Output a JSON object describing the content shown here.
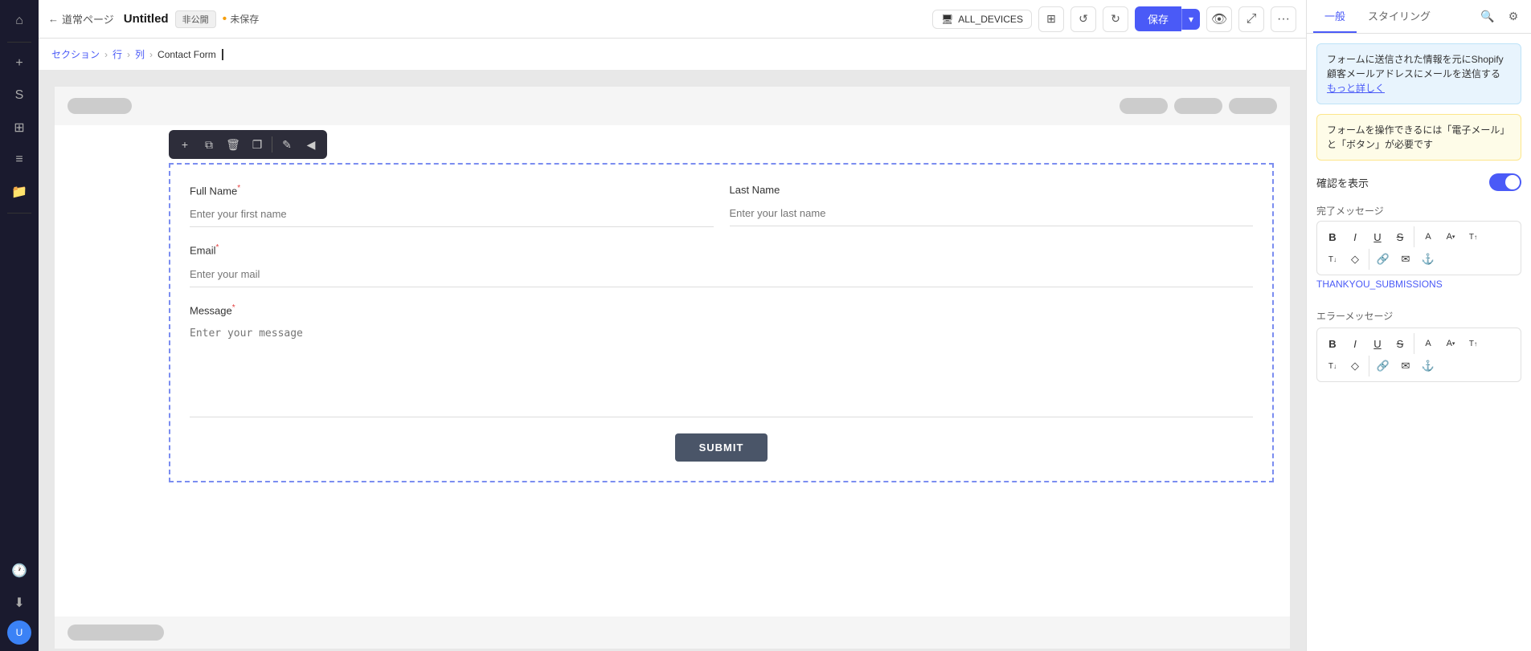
{
  "topbar": {
    "back_label": "道常ページ",
    "title": "Untitled",
    "visibility_badge": "非公開",
    "unsaved_label": "未保存",
    "device_label": "ALL_DEVICES",
    "save_label": "保存",
    "dropdown_icon": "▾",
    "more_icon": "···"
  },
  "breadcrumb": {
    "items": [
      "セクション",
      "行",
      "列",
      "Contact Form"
    ],
    "separators": [
      "›",
      "›",
      "›"
    ]
  },
  "floating_toolbar": {
    "buttons": [
      {
        "icon": "+",
        "name": "add"
      },
      {
        "icon": "⧉",
        "name": "duplicate"
      },
      {
        "icon": "🗑",
        "name": "delete"
      },
      {
        "icon": "❐",
        "name": "copy"
      },
      {
        "icon": "✏",
        "name": "edit"
      },
      {
        "icon": "◀",
        "name": "collapse"
      }
    ]
  },
  "form": {
    "full_name_label": "Full Name",
    "full_name_required": "*",
    "full_name_placeholder": "Enter your first name",
    "last_name_label": "Last Name",
    "last_name_placeholder": "Enter your last name",
    "email_label": "Email",
    "email_required": "*",
    "email_placeholder": "Enter your mail",
    "message_label": "Message",
    "message_required": "*",
    "message_placeholder": "Enter your message",
    "submit_label": "SUBMIT"
  },
  "right_panel": {
    "tabs": [
      "一般",
      "スタイリング"
    ],
    "info_text": "フォームに送信された情報を元にShopify顧客メールアドレスにメールを送信する",
    "info_link": "もっと詳しく",
    "warning_text": "フォームを操作できるには「電子メール」と「ボタン」が必要です",
    "confirm_label": "確認を表示",
    "completion_label": "完了メッセージ",
    "text_tools_row1": [
      "B",
      "I",
      "U",
      "S",
      "A",
      "A̲",
      "T↑"
    ],
    "text_tools_row2": [
      "T↓",
      "◇",
      "🔗",
      "✉",
      "🔗"
    ],
    "thankyou_text": "THANKYOU_SUBMISSIONS",
    "error_label": "エラーメッセージ",
    "error_tools_row1": [
      "B",
      "I",
      "U",
      "S",
      "A",
      "A̲",
      "T↑"
    ],
    "error_tools_row2": [
      "T↓",
      "◇",
      "🔗",
      "✉",
      "🔗"
    ],
    "search_icon": "🔍",
    "settings_icon": "⚙"
  }
}
